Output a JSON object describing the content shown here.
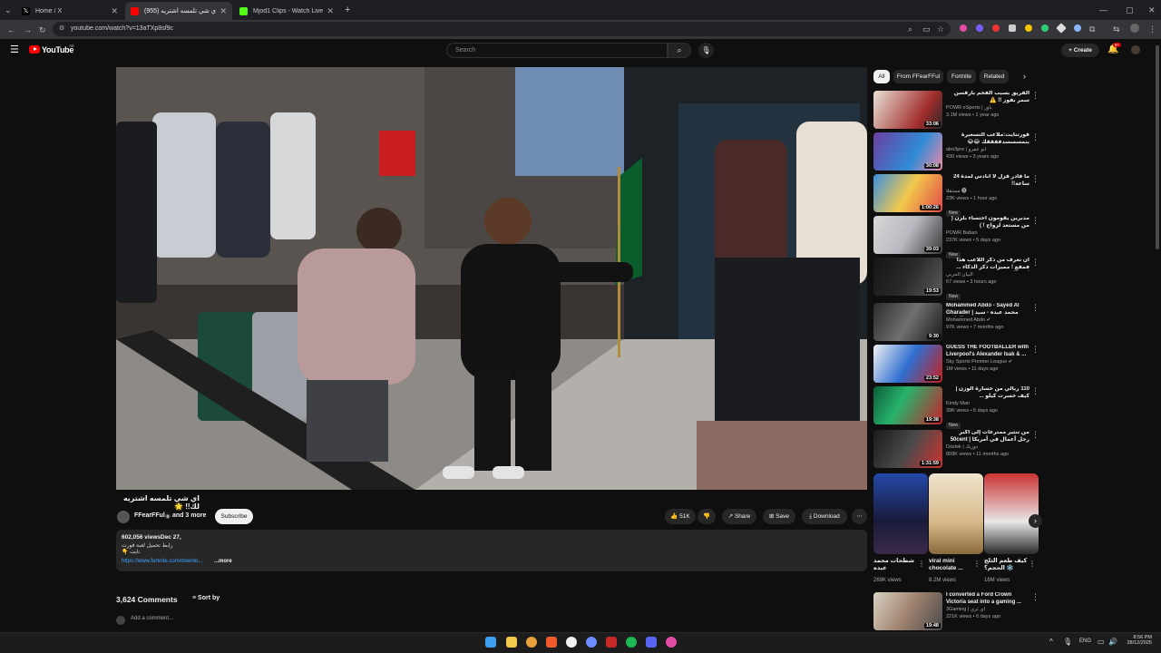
{
  "browser": {
    "tabs": [
      {
        "title": "Home / X",
        "active": false
      },
      {
        "title": "اي شي تلمسه اشتريه (955) ✉",
        "active": true
      },
      {
        "title": "Mjod1 Clips - Watch Live on Ki",
        "active": false
      }
    ],
    "new_tab": "+",
    "url": "youtube.com/watch?v=13aTXp8sf9c"
  },
  "youtube": {
    "logo": "YouTube",
    "region": "AE",
    "search_placeholder": "Search",
    "create_label": "Create",
    "notif_count": "9+"
  },
  "video": {
    "title": "اي شي تلمسه اشتريه لك!! 🌟",
    "channel": "FFearFFul",
    "and_more": "and 3 more",
    "subscribe": "Subscribe",
    "likes": "51K",
    "share": "Share",
    "save": "Save",
    "download": "Download",
    "views": "602,056 views",
    "date": "Dec 27,",
    "desc_line": "رابط تحميل لعبة فورت نايت 👇",
    "link": "https://www.fortnite.com/downlo...",
    "more": "...more",
    "comments_count": "3,624 Comments",
    "sort_by": "Sort by",
    "add_comment": "Add a comment..."
  },
  "chips": [
    "All",
    "From FFearFFul",
    "Fortnite",
    "Related"
  ],
  "recommendations": [
    {
      "title": "الفريق بسبب الفخم بأرقسن سمر بفوز !! ⚠️",
      "channel": "POWR eSports | باور",
      "meta": "3.1M views • 1 year ago",
      "duration": "33:06",
      "badge": ""
    },
    {
      "title": "فورتنايت:ملاعب التسعيرة بنمسسسدققققك 😂😂",
      "channel": "abo3pre | ابو عمرو",
      "meta": "430 views • 3 years ago",
      "duration": "30:08",
      "badge": ""
    },
    {
      "title": "ما فادر فزل لا انادس لمدة 24 ساعة!!",
      "channel": "مستقلا 🅥",
      "meta": "23K views • 1 hour ago",
      "duration": "1:00:26",
      "badge": "New"
    },
    {
      "title": "مدبرين يقومون اختساء بلزن ( من مستعد لزواج ! )",
      "channel": "POWR Baban",
      "meta": "237K views • 5 days ago",
      "duration": "39:03",
      "badge": "New"
    },
    {
      "title": "ان تعرف من ذكر اللاعب هذا فمقع ! مميزات ذكر الذكاء  ... اسد العربي",
      "channel": "البيان الحربي",
      "meta": "67 views • 3 hours ago",
      "duration": "19:53",
      "badge": "New"
    },
    {
      "title": "Mohammed Abdo - Sayed Al Gharader | محمد عبده - سيد الغادير",
      "channel": "Mohammed Abdo ✔",
      "meta": "97K views • 7 months ago",
      "duration": "9:30",
      "badge": ""
    },
    {
      "title": "GUESS THE FOOTBALLER with Liverpool's Alexander Isak & ...",
      "channel": "Sky Sports Premier League ✔",
      "meta": "1M views • 11 days ago",
      "duration": "23:52",
      "badge": ""
    },
    {
      "title": "110 ريالي من خسارة الوزن | كيف خسرت كيلو ...",
      "channel": "Kindy Man",
      "meta": "39K views • 5 days ago",
      "duration": "19:38",
      "badge": "New"
    },
    {
      "title": "من تنثير ممترعات إلى أكبر رجل أعمال في أمريكا | 50cent",
      "channel": "Doziek | دوزيك",
      "meta": "809K views • 11 months ago",
      "duration": "1:31:59",
      "badge": ""
    }
  ],
  "shorts": [
    {
      "title": "شطحات محمد عبده",
      "views": "269K views"
    },
    {
      "title": "viral mini chocolate ...",
      "views": "8.2M views"
    },
    {
      "title": "كيف طعم الثلج الحجم؟ ❄️",
      "views": "16M views"
    }
  ],
  "last_rec": {
    "title": "I converted a Ford Crown Victoria seat into a gaming ...",
    "channel": "3Gaming | اي ثري",
    "meta": "221K views • 6 days ago",
    "duration": "19:48"
  },
  "system": {
    "lang": "ENG",
    "time": "8:56 PM",
    "date": "28/12/2025"
  }
}
